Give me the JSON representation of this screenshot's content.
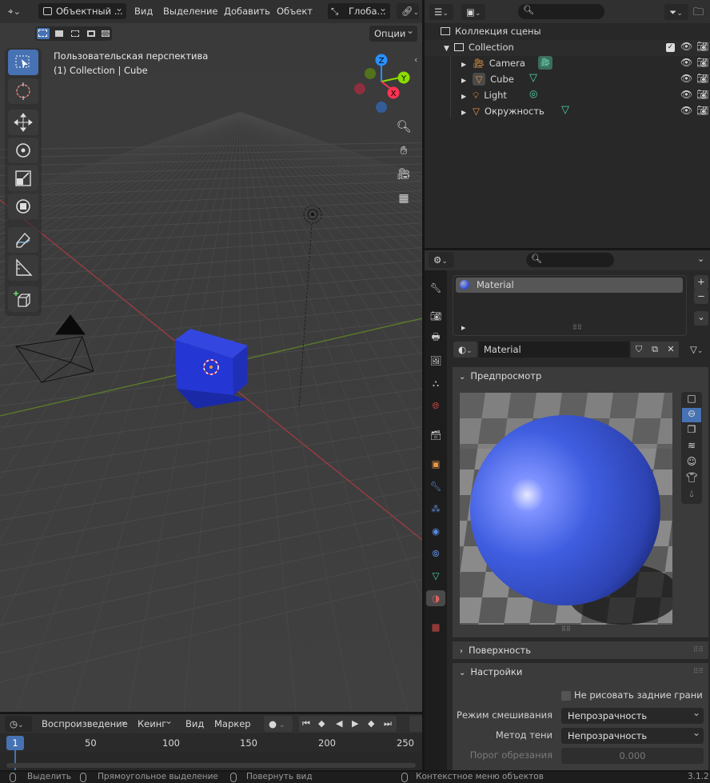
{
  "viewport": {
    "mode_label": "Объектный ...",
    "menu": [
      "Вид",
      "Выделение",
      "Добавить",
      "Объект"
    ],
    "orientation": "Глоба...",
    "options_label": "Опции",
    "overlay_line1": "Пользовательская перспектива",
    "overlay_line2": "(1) Collection | Cube",
    "gizmo": {
      "z": "Z",
      "y": "Y",
      "x": "X"
    }
  },
  "outliner": {
    "scene_collection": "Коллекция сцены",
    "collection": "Collection",
    "items": [
      {
        "name": "Camera"
      },
      {
        "name": "Cube"
      },
      {
        "name": "Light"
      },
      {
        "name": "Окружность"
      }
    ]
  },
  "properties": {
    "material_slot": "Material",
    "material_name": "Material",
    "preview_label": "Предпросмотр",
    "surface_label": "Поверхность",
    "settings_label": "Настройки",
    "backface_label": "Не рисовать задние грани",
    "blend_label": "Режим смешивания",
    "blend_value": "Непрозрачность",
    "shadow_label": "Метод тени",
    "shadow_value": "Непрозрачность",
    "clip_label": "Порог обрезания",
    "clip_value": "0.000"
  },
  "timeline": {
    "playback": "Воспроизведение",
    "keying": "Кеинг",
    "view": "Вид",
    "marker": "Маркер",
    "current_frame": "1",
    "ticks": [
      "50",
      "100",
      "150",
      "200",
      "250"
    ]
  },
  "statusbar": {
    "select": "Выделить",
    "box_select": "Прямоугольное выделение",
    "rotate": "Повернуть вид",
    "context": "Контекстное меню объектов",
    "version": "3.1.2"
  },
  "colors": {
    "accent": "#4772b3",
    "x_axis": "#ff3352",
    "y_axis": "#8bdc00",
    "z_axis": "#2890ff",
    "cube": "#2a3fd6",
    "material": "#3f5ee0"
  }
}
